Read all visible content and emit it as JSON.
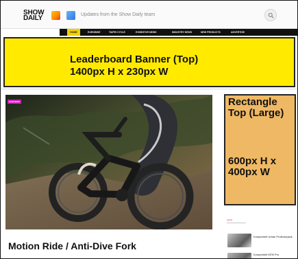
{
  "header": {
    "brand_line_1": "SHOW",
    "brand_line_2": "DAILY",
    "tagline": "Updates from the Show Daily team",
    "search_icon": "search-icon"
  },
  "nav": {
    "items": [
      {
        "label": "HOME"
      },
      {
        "label": "EUROBIKE"
      },
      {
        "label": "TAIPEI CYCLE"
      },
      {
        "label": "EXHIBITOR NEWS"
      },
      {
        "label": "INDUSTRY NEWS"
      },
      {
        "label": "NEW PRODUCTS"
      },
      {
        "label": "ADVERTISE"
      }
    ]
  },
  "ads": {
    "leaderboard": {
      "title": "Leaderboard Banner (Top)",
      "size": "1400px H x 230px W"
    },
    "sidebar": {
      "title": "Rectangle Top (Large)",
      "size": "600px H x 400px W"
    }
  },
  "hero": {
    "tag": "EUROBIKE"
  },
  "article": {
    "title": "Motion Ride / Anti-Dive Fork"
  },
  "sidebar": {
    "section_label": "Latest",
    "stories": [
      {
        "title": "Komperdell Urban Protectorjack"
      },
      {
        "title": "Komperdell MTB Pro"
      }
    ]
  },
  "colors": {
    "nav_active": "#f4d000",
    "leaderboard_bg": "#ffea00",
    "sidebar_bg": "#efb864",
    "hero_tag": "#d020b9",
    "section_accent": "#d22222"
  }
}
